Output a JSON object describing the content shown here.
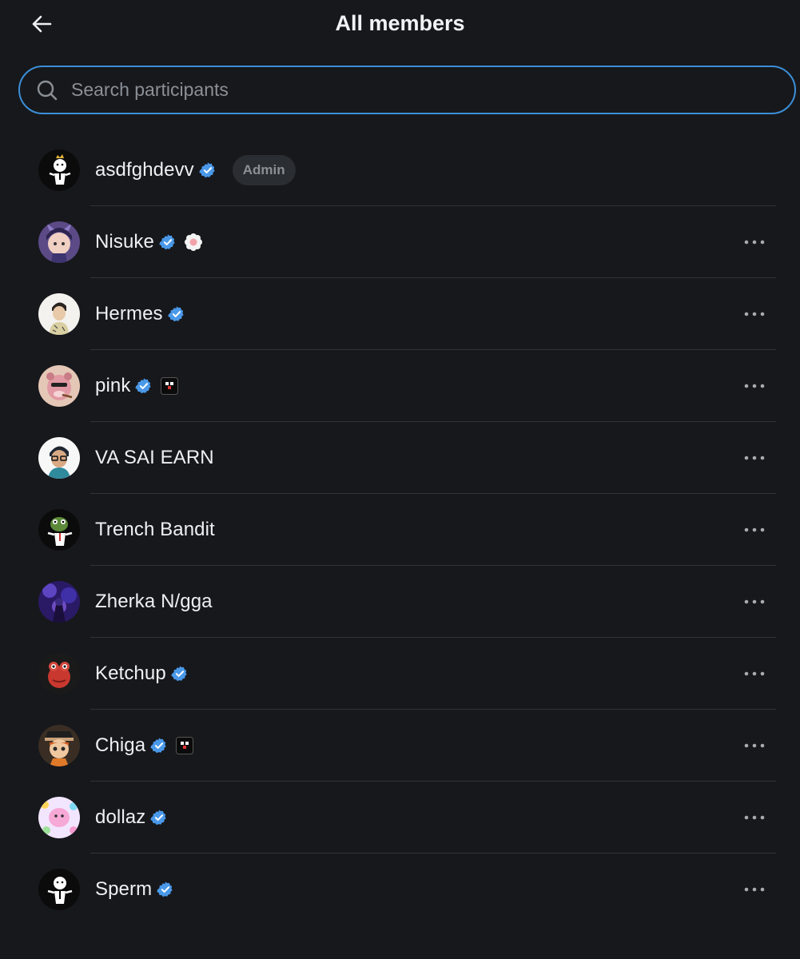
{
  "header": {
    "title": "All members",
    "back_icon": "arrow-left-icon"
  },
  "search": {
    "placeholder": "Search participants",
    "value": "",
    "icon": "search-icon"
  },
  "admin_badge_label": "Admin",
  "colors": {
    "background": "#17181c",
    "accent": "#3b8fd8",
    "verified": "#4a99e9",
    "divider": "#2f3336"
  },
  "members": [
    {
      "name": "asdfghdevv",
      "verified": true,
      "admin": true,
      "extra": ""
    },
    {
      "name": "Nisuke",
      "verified": true,
      "admin": false,
      "extra": "flower-emoji"
    },
    {
      "name": "Hermes",
      "verified": true,
      "admin": false,
      "extra": ""
    },
    {
      "name": "pink",
      "verified": true,
      "admin": false,
      "extra": "affiliate-badge"
    },
    {
      "name": "VA SAI EARN",
      "verified": false,
      "admin": false,
      "extra": ""
    },
    {
      "name": "Trench Bandit",
      "verified": false,
      "admin": false,
      "extra": ""
    },
    {
      "name": "Zherka N/gga",
      "verified": false,
      "admin": false,
      "extra": ""
    },
    {
      "name": "Ketchup",
      "verified": true,
      "admin": false,
      "extra": ""
    },
    {
      "name": "Chiga",
      "verified": true,
      "admin": false,
      "extra": "affiliate-badge"
    },
    {
      "name": "dollaz",
      "verified": true,
      "admin": false,
      "extra": ""
    },
    {
      "name": "Sperm",
      "verified": true,
      "admin": false,
      "extra": ""
    }
  ]
}
